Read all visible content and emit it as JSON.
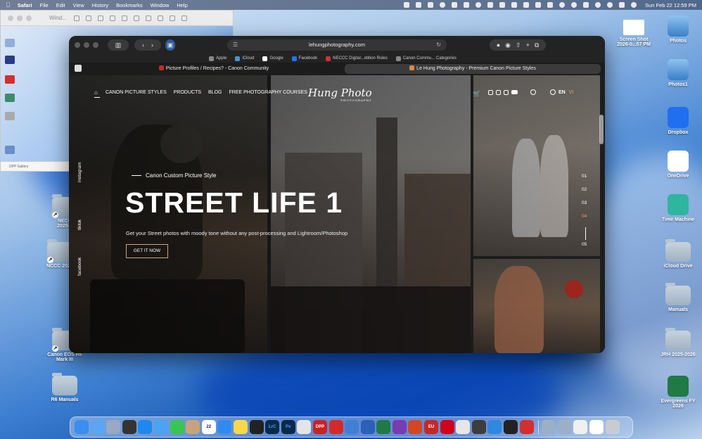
{
  "menubar": {
    "app": "Safari",
    "items": [
      "File",
      "Edit",
      "View",
      "History",
      "Bookmarks",
      "Window",
      "Help"
    ],
    "clock": "Sun Feb 22  12:59 PM"
  },
  "bg_window": {
    "title": "Wind...",
    "strip_text": "DPP Gallery"
  },
  "desktop_left": [
    {
      "label": "NECC\n2025-2"
    },
    {
      "label": "NCCC 2025"
    },
    {
      "label": "Canon EOS R6\nMark III"
    },
    {
      "label": "R6 Manuals"
    }
  ],
  "desktop_right": [
    {
      "label": "Screen Shot\n2026-0...57 PM"
    },
    {
      "label": "Photos"
    },
    {
      "label": "Photos1"
    },
    {
      "label": "Dropbox"
    },
    {
      "label": "OneDrive"
    },
    {
      "label": "Time Machine"
    },
    {
      "label": "iCloud Drive"
    },
    {
      "label": "Manuals"
    },
    {
      "label": "JRH 2025-2026"
    },
    {
      "label": "Evergreens FY\n2026"
    }
  ],
  "browser": {
    "url": "lehungphotography.com",
    "favorites": [
      {
        "label": "Apple",
        "color": "#888888"
      },
      {
        "label": "iCloud",
        "color": "#4a90d9"
      },
      {
        "label": "Google",
        "color": "#ffffff"
      },
      {
        "label": "Facebook",
        "color": "#1877f2"
      },
      {
        "label": "NECCC Digital...etition Rules",
        "color": "#cc3333"
      },
      {
        "label": "Canon Commu... Categories",
        "color": "#888888"
      }
    ],
    "tabs": [
      {
        "label": "Picture Profiles / Recipes? - Canon Community",
        "active": false
      },
      {
        "label": "Le Hung Photography - Premium Canon Picture Styles",
        "active": true
      }
    ]
  },
  "site": {
    "nav": [
      "CANON PICTURE STYLES",
      "PRODUCTS",
      "BLOG",
      "FREE PHOTOGRAPHY COURSES"
    ],
    "logo": "Hung Photo",
    "logo_sub": "PHOTOGRAPHY",
    "lang_en": "EN",
    "lang_vi": "VI",
    "social": [
      "instagram",
      "tiktok",
      "facebook"
    ],
    "hero_sub": "Canon Custom Picture Style",
    "hero_title": "STREET LIFE 1",
    "hero_desc": "Get your Street photos with moody tone without any post-processing and Lightroom/Photoshop",
    "cta": "GET IT NOW",
    "slides": [
      "01",
      "02",
      "03",
      "04",
      "05"
    ],
    "active_slide": "04"
  },
  "dock": {
    "apps": [
      {
        "name": "finder",
        "color": "#3b8df0"
      },
      {
        "name": "icloud",
        "color": "#5aa6f2"
      },
      {
        "name": "launchpad",
        "color": "#9aa8c5"
      },
      {
        "name": "mission-control",
        "color": "#333333"
      },
      {
        "name": "app-store",
        "color": "#1e88f0"
      },
      {
        "name": "mail",
        "color": "#4aa3f5"
      },
      {
        "name": "messages",
        "color": "#39c552"
      },
      {
        "name": "contacts",
        "color": "#c8a27a"
      },
      {
        "name": "calendar",
        "color": "#ffffff"
      },
      {
        "name": "safari",
        "color": "#2f8bf2"
      },
      {
        "name": "notes",
        "color": "#f8d84a"
      },
      {
        "name": "camera-connect",
        "color": "#222222"
      },
      {
        "name": "lightroom",
        "color": "#0b2a4a"
      },
      {
        "name": "photoshop",
        "color": "#0b2a4a"
      },
      {
        "name": "camera-app",
        "color": "#e5e5e5"
      },
      {
        "name": "dpp",
        "color": "#cc2222"
      },
      {
        "name": "eos-utility",
        "color": "#d42a2a"
      },
      {
        "name": "picture-style-editor",
        "color": "#3f7fd6"
      },
      {
        "name": "word",
        "color": "#2b5fb8"
      },
      {
        "name": "excel",
        "color": "#1f7a45"
      },
      {
        "name": "onenote",
        "color": "#7a3bb0"
      },
      {
        "name": "powerpoint",
        "color": "#d24726"
      },
      {
        "name": "eu-app",
        "color": "#c62828"
      },
      {
        "name": "quicken",
        "color": "#d0021b"
      },
      {
        "name": "font-book",
        "color": "#e6e6e6"
      },
      {
        "name": "piano",
        "color": "#3d3d3d"
      },
      {
        "name": "windows-app",
        "color": "#2e88e0"
      },
      {
        "name": "clock-app",
        "color": "#222222"
      },
      {
        "name": "checkmark-app",
        "color": "#d32f2f"
      },
      {
        "name": "folder-1",
        "color": "#9bb0c6"
      },
      {
        "name": "folder-2",
        "color": "#9bb0c6"
      },
      {
        "name": "document",
        "color": "#f0f0f0"
      },
      {
        "name": "screenshot",
        "color": "#ffffff"
      },
      {
        "name": "trash",
        "color": "#c8ccd2"
      }
    ],
    "labels": {
      "calendar": "22",
      "lightroom": "LrC",
      "photoshop": "Ps",
      "dpp": "DPP",
      "eu": "EU"
    }
  },
  "colors": {
    "accent": "#e4a46c",
    "cta_border": "#c9a57a"
  }
}
